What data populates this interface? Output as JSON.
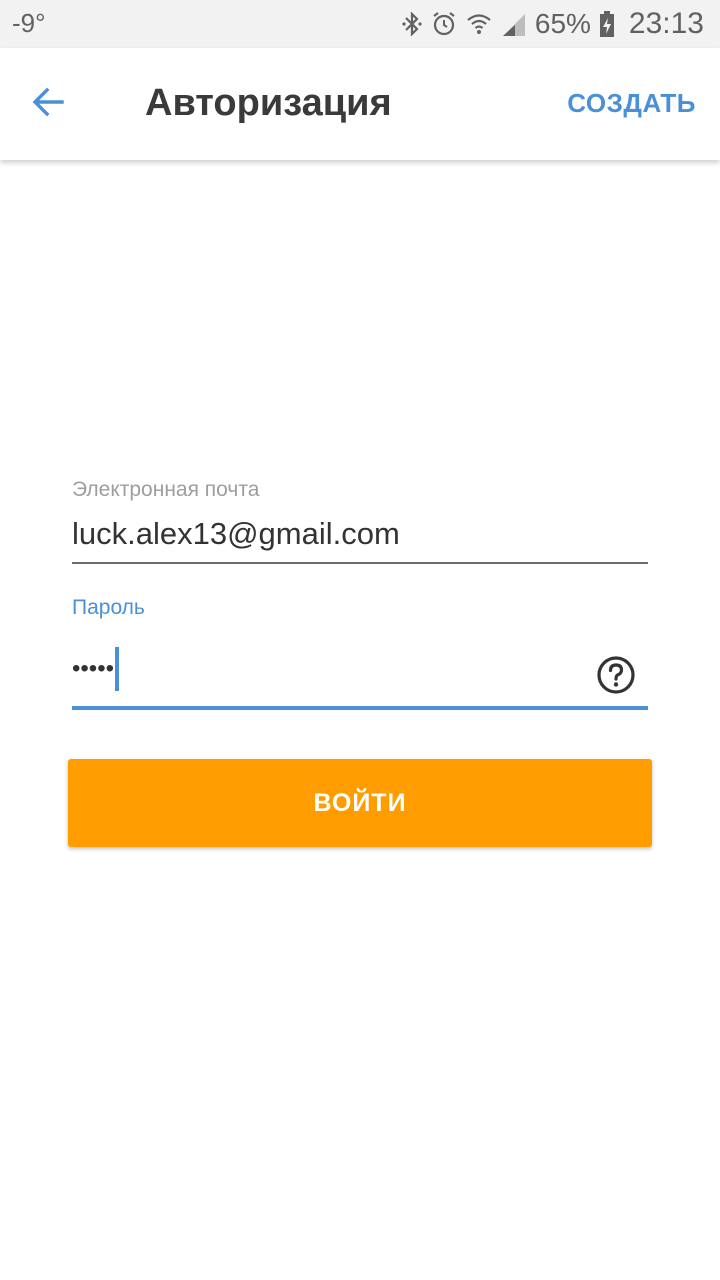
{
  "status_bar": {
    "temperature": "-9°",
    "battery_percent": "65%",
    "time": "23:13",
    "icons": [
      "bluetooth-icon",
      "alarm-icon",
      "wifi-icon",
      "signal-icon",
      "battery-charging-icon"
    ]
  },
  "app_bar": {
    "back_icon": "arrow-back-icon",
    "title": "Авторизация",
    "create_label": "СОЗДАТЬ"
  },
  "form": {
    "email": {
      "label": "Электронная почта",
      "value": "luck.alex13@gmail.com"
    },
    "password": {
      "label": "Пароль",
      "masked_value": "•••••",
      "help_icon": "help-circle-icon"
    }
  },
  "login_button": {
    "label": "ВОЙТИ"
  },
  "colors": {
    "accent": "#4a90d9",
    "button": "#ff9c00",
    "title": "#3a3a3a"
  }
}
